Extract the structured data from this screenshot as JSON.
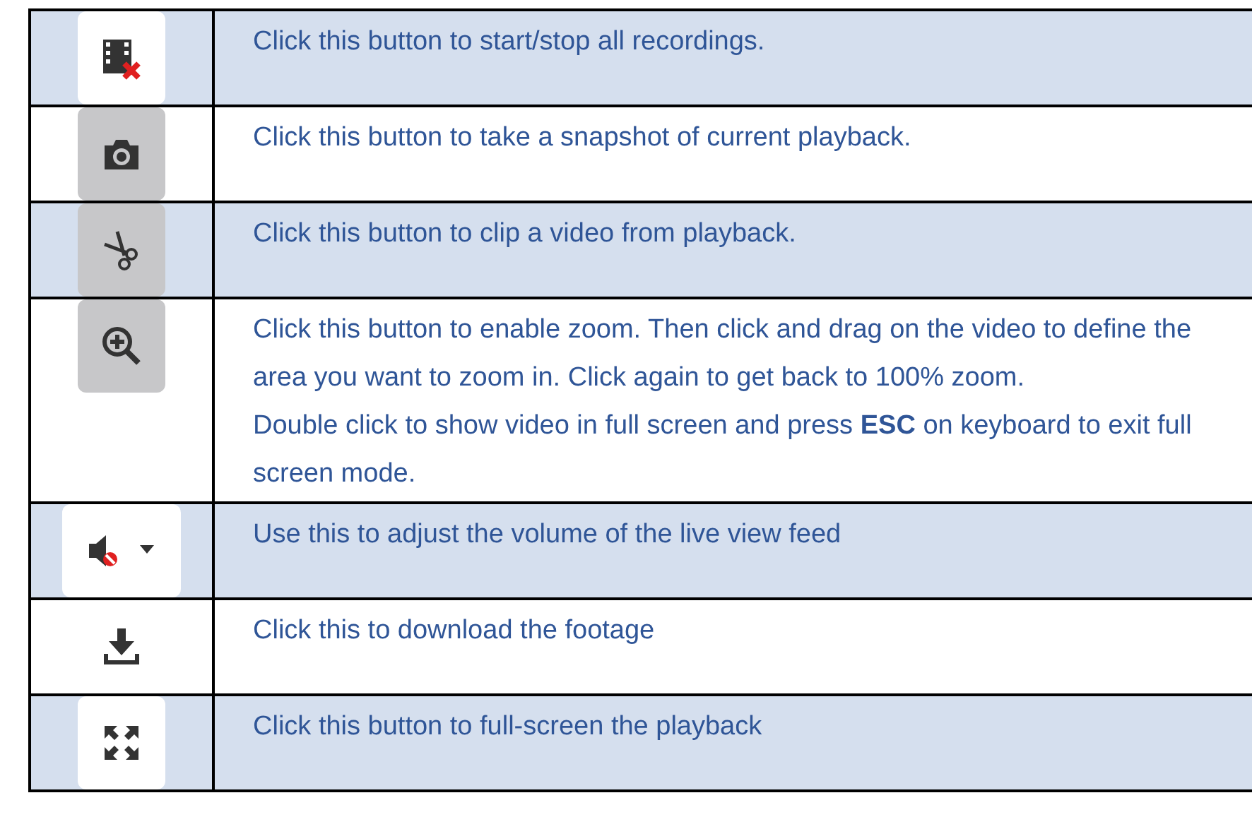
{
  "rows": [
    {
      "kind": "film-stop",
      "greyed": false,
      "shaded": true,
      "paragraphs": [
        "Click this button to start/stop all recordings."
      ]
    },
    {
      "kind": "camera",
      "greyed": true,
      "shaded": false,
      "paragraphs": [
        "Click this button to take a snapshot of current playback."
      ]
    },
    {
      "kind": "scissors",
      "greyed": true,
      "shaded": true,
      "paragraphs": [
        "Click this button to clip a video from playback."
      ]
    },
    {
      "kind": "zoom",
      "greyed": true,
      "shaded": false,
      "paragraphs": [
        "Click this button to enable zoom. Then click and drag on the video to define the area you want to zoom in. Click again to get back to 100% zoom.",
        "Double click to show video in full screen and press **ESC** on keyboard to exit full screen mode."
      ]
    },
    {
      "kind": "volume",
      "greyed": false,
      "shaded": true,
      "paragraphs": [
        "Use this to adjust the volume of the live view feed"
      ]
    },
    {
      "kind": "download",
      "greyed": false,
      "shaded": false,
      "paragraphs": [
        "Click this to download the footage"
      ]
    },
    {
      "kind": "fullscreen",
      "greyed": false,
      "shaded": true,
      "paragraphs": [
        "Click this button to full-screen the playback"
      ]
    }
  ]
}
